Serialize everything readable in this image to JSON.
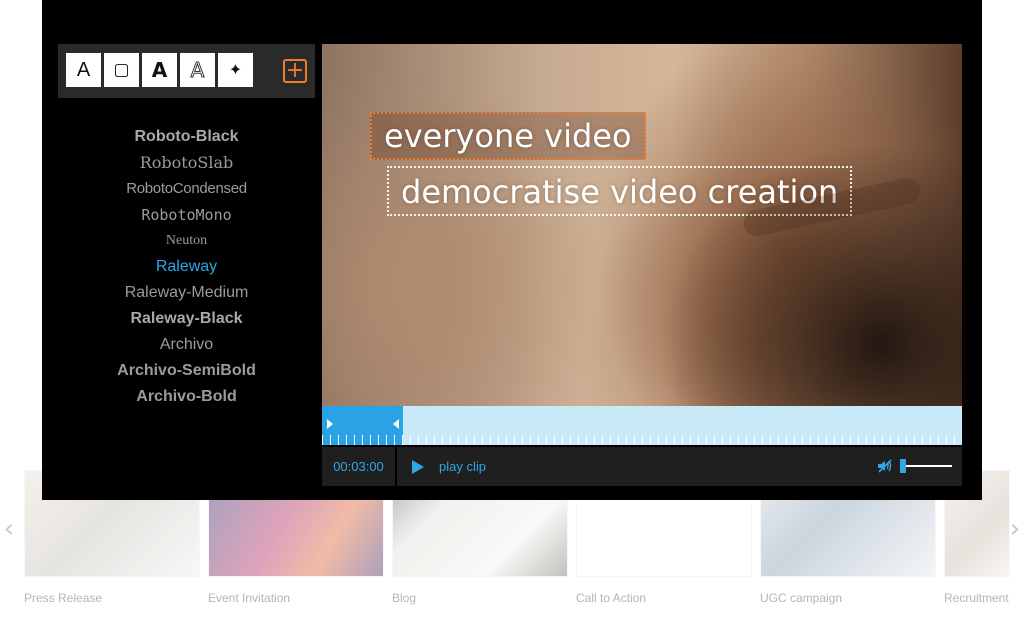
{
  "carousel": {
    "prev_icon": "‹",
    "next_icon": "›",
    "templates": [
      {
        "label": "Press Release"
      },
      {
        "label": "Event Invitation"
      },
      {
        "label": "Blog"
      },
      {
        "label": "Call to Action"
      },
      {
        "label": "UGC campaign"
      },
      {
        "label": "Recruitment"
      }
    ]
  },
  "toolbar": {
    "tools": [
      {
        "icon": "text-plain-icon",
        "glyph": "A"
      },
      {
        "icon": "text-box-icon",
        "glyph": "▢"
      },
      {
        "icon": "text-bold-icon",
        "glyph": "A"
      },
      {
        "icon": "text-outline-icon",
        "glyph": "A"
      },
      {
        "icon": "sparkle-effect-icon",
        "glyph": "✦"
      }
    ],
    "add_glyph": "+",
    "accent_color": "#f07d2d"
  },
  "fonts": [
    "Roboto-Black",
    "RobotoSlab",
    "RobotoCondensed",
    "RobotoMono",
    "Neuton",
    "Raleway",
    "Raleway-Medium",
    "Raleway-Black",
    "Archivo",
    "Archivo-SemiBold",
    "Archivo-Bold"
  ],
  "selected_font": "Raleway",
  "captions": {
    "line1": "everyone video",
    "line2": "democratise video creation"
  },
  "timeline": {
    "selection_fraction": 0.127,
    "selection_color": "#29a3e4",
    "track_color": "#c7e9f8"
  },
  "player": {
    "time": "00:03:00",
    "play_label": "play clip",
    "volume_fraction": 0.0,
    "muted": true,
    "accent_color": "#2fa6e6"
  }
}
